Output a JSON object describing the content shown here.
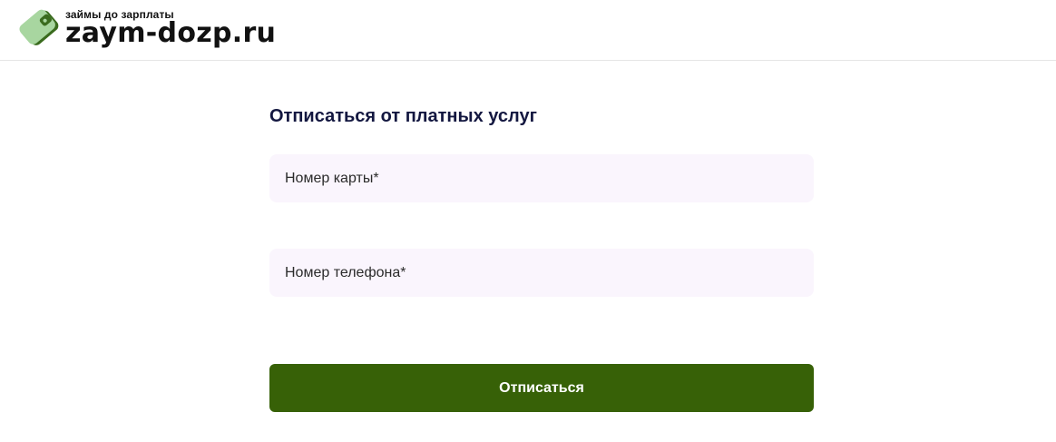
{
  "header": {
    "logo": {
      "tagline": "займы до зарплаты",
      "name": "zaym-dozp.ru",
      "icon": "wallet-icon"
    }
  },
  "form": {
    "title": "Отписаться от платных услуг",
    "card_field": {
      "placeholder": "Номер карты*",
      "value": ""
    },
    "phone_field": {
      "placeholder": "Номер телефона*",
      "value": ""
    },
    "submit_label": "Отписаться"
  },
  "colors": {
    "brand_green": "#376107",
    "logo_light_green": "#a8d6a0",
    "logo_dark_green": "#3a6b1e",
    "title_navy": "#131740",
    "input_background": "#faf5fd"
  }
}
